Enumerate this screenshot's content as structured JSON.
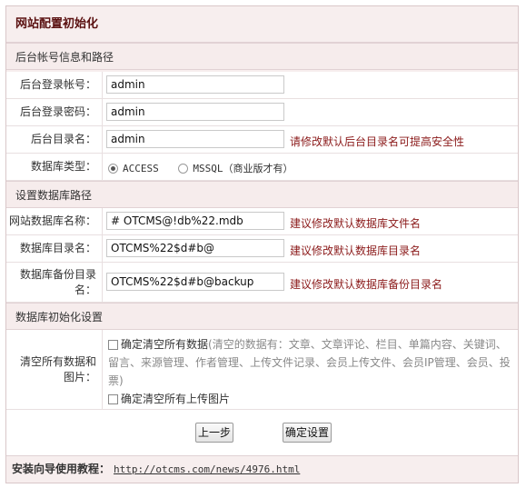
{
  "header": {
    "title": "网站配置初始化"
  },
  "sections": {
    "admin": "后台帐号信息和路径",
    "db": "设置数据库路径",
    "init": "数据库初始化设置"
  },
  "fields": {
    "admin_user": {
      "label": "后台登录帐号：",
      "value": "admin"
    },
    "admin_pwd": {
      "label": "后台登录密码：",
      "value": "admin"
    },
    "admin_dir": {
      "label": "后台目录名：",
      "value": "admin",
      "hint": "请修改默认后台目录名可提高安全性"
    },
    "db_type": {
      "label": "数据库类型：",
      "options": [
        "ACCESS",
        "MSSQL（商业版才有）"
      ],
      "selected": "ACCESS"
    },
    "db_name": {
      "label": "网站数据库名称：",
      "value": "# OTCMS@!db%22.mdb",
      "hint": "建议修改默认数据库文件名"
    },
    "db_dir": {
      "label": "数据库目录名：",
      "value": "OTCMS%22$d#b@",
      "hint": "建议修改默认数据库目录名"
    },
    "db_backup": {
      "label": "数据库备份目录名：",
      "value": "OTCMS%22$d#b@backup",
      "hint": "建议修改默认数据库备份目录名"
    },
    "clear": {
      "label": "清空所有数据和图片：",
      "clear_data_label": "确定清空所有数据",
      "clear_data_note": "(清空的数据有：文章、文章评论、栏目、单篇内容、关键词、留言、来源管理、作者管理、上传文件记录、会员上传文件、会员IP管理、会员、投票)",
      "clear_images_label": "确定清空所有上传图片"
    }
  },
  "buttons": {
    "prev": "上一步",
    "confirm": "确定设置"
  },
  "footer": {
    "label": "安装向导使用教程：",
    "link": "http://otcms.com/news/4976.html"
  },
  "colors": {
    "hint": "#8b1a1a",
    "title": "#5a1010",
    "border": "#d9c7c9"
  }
}
